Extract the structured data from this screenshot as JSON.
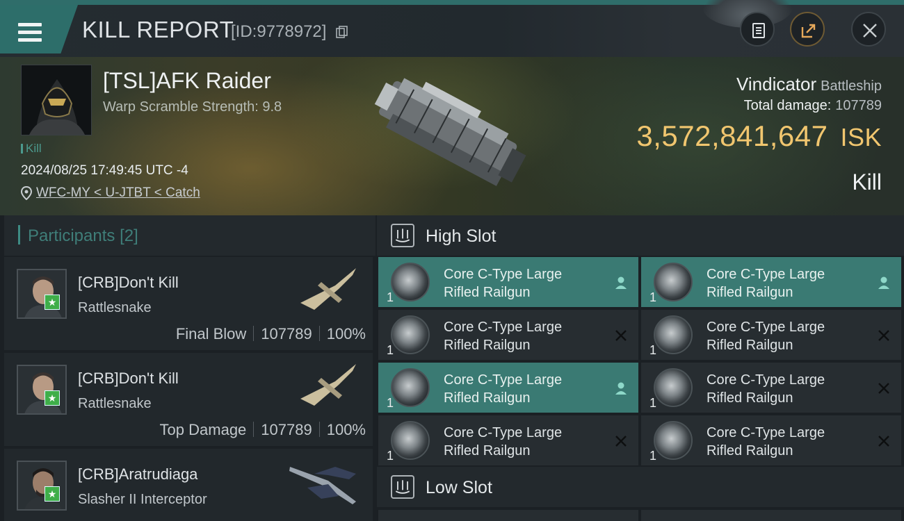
{
  "header": {
    "title": "KILL REPORT",
    "report_id": "[ID:9778972]",
    "icons": [
      "menu-icon",
      "copy-icon",
      "clipboard-icon",
      "share-icon",
      "close-icon"
    ]
  },
  "victim": {
    "pilot": "[TSL]AFK Raider",
    "warp_scramble": "Warp Scramble Strength: 9.8",
    "tag": "Kill",
    "datetime": "2024/08/25 17:49:45 UTC -4",
    "location": "WFC-MY < U-JTBT < Catch",
    "ship": "Vindicator",
    "ship_class": "Battleship",
    "total_damage_label": "Total damage:",
    "total_damage": "107789",
    "isk_value": "3,572,841,647",
    "isk_currency": "ISK",
    "result": "Kill"
  },
  "participants": {
    "title": "Participants",
    "count": "[2]",
    "rows": [
      {
        "name": "[CRB]Don't Kill",
        "ship": "Rattlesnake",
        "role": "Final Blow",
        "damage": "107789",
        "percent": "100%"
      },
      {
        "name": "[CRB]Don't Kill",
        "ship": "Rattlesnake",
        "role": "Top Damage",
        "damage": "107789",
        "percent": "100%"
      },
      {
        "name": "[CRB]Aratrudiaga",
        "ship": "Slasher II Interceptor",
        "role": "",
        "damage": "",
        "percent": ""
      }
    ]
  },
  "slots": {
    "high": {
      "label": "High Slot",
      "items": [
        {
          "line1": "Core C-Type Large",
          "line2": "Rifled Railgun",
          "qty": "1",
          "status": "person-icon"
        },
        {
          "line1": "Core C-Type Large",
          "line2": "Rifled Railgun",
          "qty": "1",
          "status": "person-icon"
        },
        {
          "line1": "Core C-Type Large",
          "line2": "Rifled Railgun",
          "qty": "1",
          "status": "destroyed-icon"
        },
        {
          "line1": "Core C-Type Large",
          "line2": "Rifled Railgun",
          "qty": "1",
          "status": "destroyed-icon"
        },
        {
          "line1": "Core C-Type Large",
          "line2": "Rifled Railgun",
          "qty": "1",
          "status": "person-icon"
        },
        {
          "line1": "Core C-Type Large",
          "line2": "Rifled Railgun",
          "qty": "1",
          "status": "destroyed-icon"
        },
        {
          "line1": "Core C-Type Large",
          "line2": "Rifled Railgun",
          "qty": "1",
          "status": "destroyed-icon"
        },
        {
          "line1": "Core C-Type Large",
          "line2": "Rifled Railgun",
          "qty": "1",
          "status": "destroyed-icon"
        }
      ]
    },
    "low": {
      "label": "Low Slot"
    }
  },
  "colors": {
    "accent": "#2f6d6a",
    "isk": "#f1c66f",
    "active_item": "#3a7a73",
    "star": "#3fae49"
  }
}
